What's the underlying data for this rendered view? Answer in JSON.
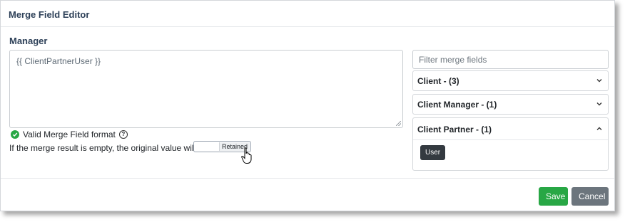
{
  "dialog": {
    "title": "Merge Field Editor",
    "field_label": "Manager"
  },
  "editor": {
    "value": "{{ ClientPartnerUser }}"
  },
  "validation": {
    "text": "Valid Merge Field format",
    "status_color": "#28a745"
  },
  "empty_result": {
    "text": "If the merge result is empty, the original value will be",
    "selected_option": "Retained"
  },
  "sidebar": {
    "filter_placeholder": "Filter merge fields",
    "groups": [
      {
        "label": "Client - (3)",
        "expanded": false
      },
      {
        "label": "Client Manager - (1)",
        "expanded": false
      },
      {
        "label": "Client Partner - (1)",
        "expanded": true,
        "items": [
          "User"
        ]
      }
    ]
  },
  "footer": {
    "save_label": "Save",
    "cancel_label": "Cancel",
    "save_color": "#28a745",
    "cancel_color": "#6c757d"
  }
}
